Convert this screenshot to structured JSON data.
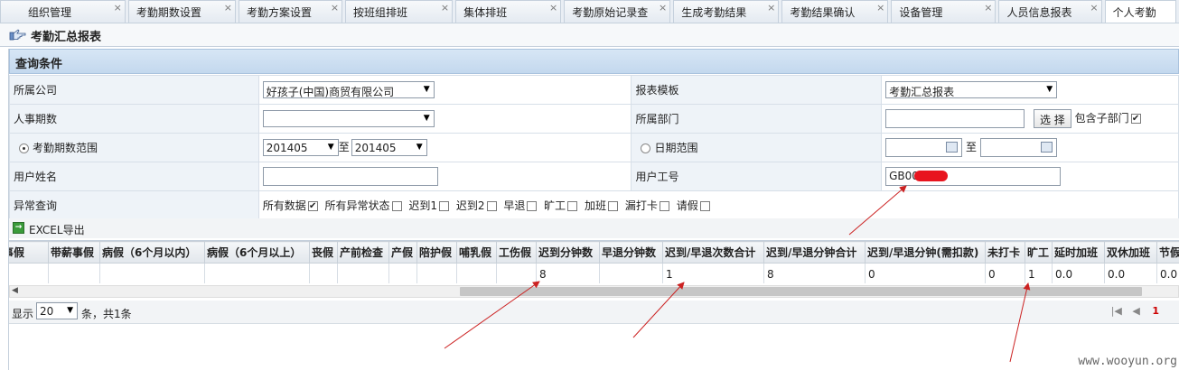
{
  "tabs": [
    {
      "label": "组织管理"
    },
    {
      "label": "考勤期数设置"
    },
    {
      "label": "考勤方案设置"
    },
    {
      "label": "按班组排班"
    },
    {
      "label": "集体排班"
    },
    {
      "label": "考勤原始记录查"
    },
    {
      "label": "生成考勤结果"
    },
    {
      "label": "考勤结果确认"
    },
    {
      "label": "设备管理"
    },
    {
      "label": "人员信息报表"
    },
    {
      "label": "个人考勤"
    }
  ],
  "tab_close_glyph": "×",
  "page_title": "考勤汇总报表",
  "query_header": "查询条件",
  "form": {
    "company_label": "所属公司",
    "company_value": "好孩子(中国)商贸有限公司",
    "template_label": "报表模板",
    "template_value": "考勤汇总报表",
    "hr_period_label": "人事期数",
    "hr_period_value": "",
    "dept_label": "所属部门",
    "dept_value": "",
    "select_button": "选 择",
    "include_sub_label": "包含子部门",
    "period_range_label": "考勤期数范围",
    "period_from": "201405",
    "period_to": "201405",
    "to_word": "至",
    "date_range_label": "日期范围",
    "date_from": "",
    "date_to": "",
    "user_name_label": "用户姓名",
    "user_name_value": "",
    "user_id_label": "用户工号",
    "user_id_value": "GB00",
    "exception_label": "异常查询",
    "exception_options": [
      {
        "label": "所有数据",
        "checked": true
      },
      {
        "label": "所有异常状态",
        "checked": false
      },
      {
        "label": "迟到1",
        "checked": false
      },
      {
        "label": "迟到2",
        "checked": false
      },
      {
        "label": "早退",
        "checked": false
      },
      {
        "label": "旷工",
        "checked": false
      },
      {
        "label": "加班",
        "checked": false
      },
      {
        "label": "漏打卡",
        "checked": false
      },
      {
        "label": "请假",
        "checked": false
      }
    ]
  },
  "excel_export": "EXCEL导出",
  "table": {
    "columns": [
      "事假",
      "带薪事假",
      "病假（6个月以内）",
      "病假（6个月以上）",
      "丧假",
      "产前检查",
      "产假",
      "陪护假",
      "哺乳假",
      "工伤假",
      "迟到分钟数",
      "早退分钟数",
      "迟到/早退次数合计",
      "迟到/早退分钟合计",
      "迟到/早退分钟(需扣款)",
      "未打卡",
      "旷工",
      "延时加班",
      "双休加班",
      "节假"
    ],
    "rows": [
      [
        "",
        "",
        "",
        "",
        "",
        "",
        "",
        "",
        "",
        "",
        "8",
        "",
        "1",
        "8",
        "0",
        "0",
        "1",
        "0.0",
        "0.0",
        "0.0"
      ]
    ]
  },
  "pager": {
    "show_label": "显示",
    "page_size": "20",
    "summary": "条，共1条",
    "current_page": "1"
  },
  "watermark": "www.wooyun.org",
  "colors": {
    "tab_bg": "#e9eef4",
    "header_blue": "#c3d8ee",
    "label_bg": "#eef3f8",
    "redaction": "#e8141e",
    "arrow": "#cc2222"
  }
}
